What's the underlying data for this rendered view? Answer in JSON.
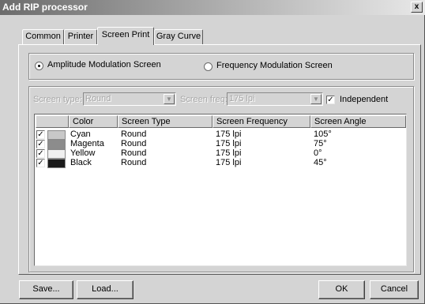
{
  "window": {
    "title": "Add RIP processor",
    "close_label": "x"
  },
  "tabs": [
    {
      "label": "Common"
    },
    {
      "label": "Printer"
    },
    {
      "label": "Screen Print",
      "active": true
    },
    {
      "label": "Gray Curve"
    }
  ],
  "modulation": {
    "am_label": "Amplitude Modulation Screen",
    "am_selected": true,
    "fm_label": "Frequency Modulation Screen",
    "fm_selected": false
  },
  "screen_settings": {
    "type_label": "Screen type:",
    "type_value": "Round",
    "freq_label": "Screen freq:",
    "freq_value": "175 lpi",
    "independent_label": "Independent",
    "independent_checked": true
  },
  "table": {
    "columns": [
      "Color",
      "Screen Type",
      "Screen Frequency",
      "Screen Angle"
    ],
    "rows": [
      {
        "checked": true,
        "swatch": "#c8c8c8",
        "color": "Cyan",
        "type": "Round",
        "freq": "175 lpi",
        "angle": "105°"
      },
      {
        "checked": true,
        "swatch": "#8c8c8c",
        "color": "Magenta",
        "type": "Round",
        "freq": "175 lpi",
        "angle": "75°"
      },
      {
        "checked": true,
        "swatch": "#f0f0f0",
        "color": "Yellow",
        "type": "Round",
        "freq": "175 lpi",
        "angle": "0°"
      },
      {
        "checked": true,
        "swatch": "#1a1a1a",
        "color": "Black",
        "type": "Round",
        "freq": "175 lpi",
        "angle": "45°"
      }
    ]
  },
  "buttons": {
    "save": "Save...",
    "load": "Load...",
    "ok": "OK",
    "cancel": "Cancel"
  }
}
